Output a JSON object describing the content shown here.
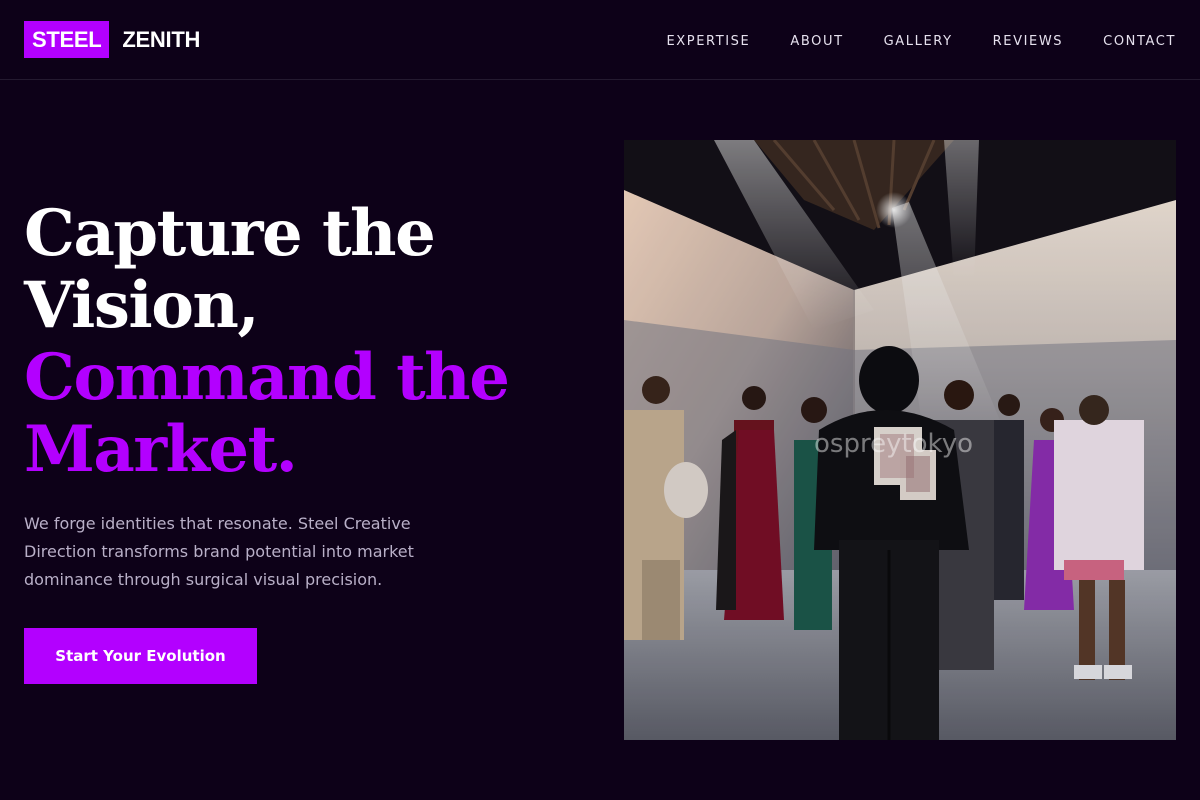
{
  "brand": {
    "box_text": "STEEL",
    "word_text": "ZENITH",
    "accent_color": "#b300ff"
  },
  "nav": {
    "links": [
      {
        "label": "EXPERTISE"
      },
      {
        "label": "ABOUT"
      },
      {
        "label": "GALLERY"
      },
      {
        "label": "REVIEWS"
      },
      {
        "label": "CONTACT"
      }
    ]
  },
  "hero": {
    "headline_lines": [
      "Capture the",
      "Vision,"
    ],
    "headline_accent_lines": [
      "Command the",
      "Market."
    ],
    "subtext": "We forge identities that resonate. Steel Creative Direction transforms brand potential into market dominance through surgical visual precision.",
    "cta_label": "Start Your Evolution"
  },
  "photo": {
    "watermark": "ospreytokyo"
  },
  "colors": {
    "background": "#0d0118",
    "accent": "#b300ff",
    "text": "#ffffff",
    "muted_text": "#b9b0c8"
  }
}
